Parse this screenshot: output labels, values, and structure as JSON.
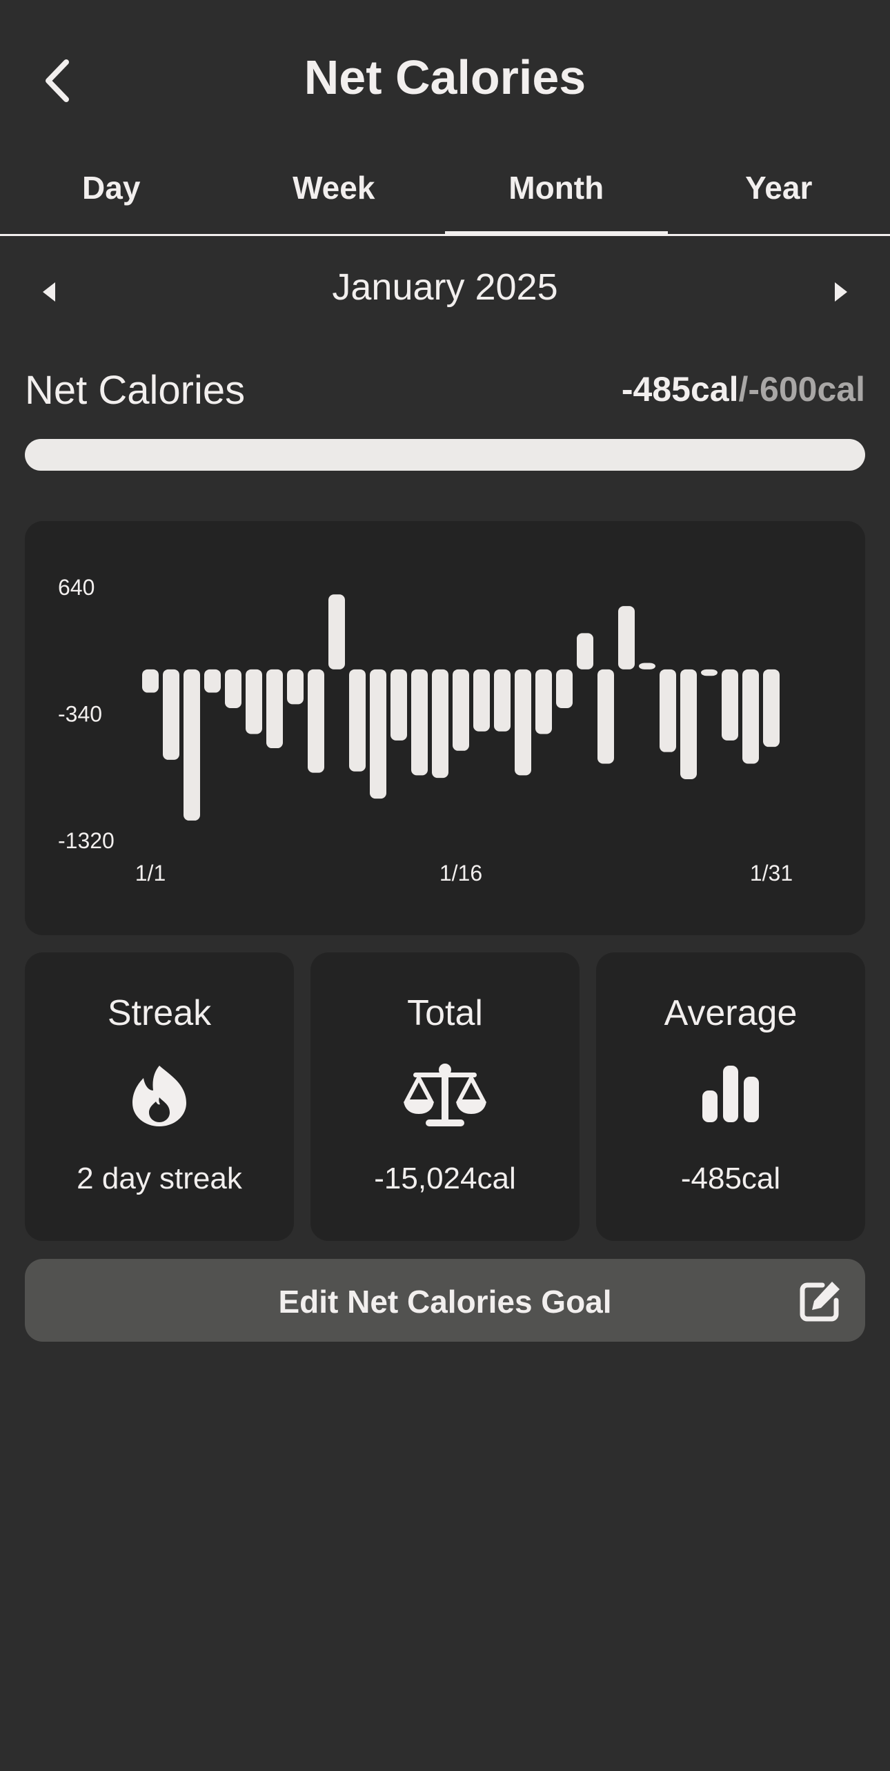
{
  "header": {
    "title": "Net Calories"
  },
  "tabs": [
    {
      "label": "Day"
    },
    {
      "label": "Week"
    },
    {
      "label": "Month"
    },
    {
      "label": "Year"
    }
  ],
  "active_tab": "Month",
  "period": {
    "label": "January 2025"
  },
  "summary": {
    "label": "Net Calories",
    "value": "-485cal",
    "separator": "/",
    "goal": "-600cal",
    "progress_fraction": 1.0
  },
  "chart_data": {
    "type": "bar",
    "x": [
      "1/1",
      "1/2",
      "1/3",
      "1/4",
      "1/5",
      "1/6",
      "1/7",
      "1/8",
      "1/9",
      "1/10",
      "1/11",
      "1/12",
      "1/13",
      "1/14",
      "1/15",
      "1/16",
      "1/17",
      "1/18",
      "1/19",
      "1/20",
      "1/21",
      "1/22",
      "1/23",
      "1/24",
      "1/25",
      "1/26",
      "1/27",
      "1/28",
      "1/29",
      "1/30",
      "1/31"
    ],
    "values": [
      -180,
      -700,
      -1170,
      -180,
      -300,
      -500,
      -610,
      -270,
      -800,
      580,
      -790,
      -1000,
      -550,
      -820,
      -840,
      -630,
      -480,
      -480,
      -820,
      -500,
      -300,
      280,
      -730,
      490,
      50,
      -640,
      -850,
      -50,
      -550,
      -730,
      -600
    ],
    "x_tick_labels": [
      "1/1",
      "1/16",
      "1/31"
    ],
    "y_tick_labels": [
      "640",
      "-340",
      "-1320"
    ],
    "ylim": [
      -1320,
      640
    ],
    "grid": false,
    "bar_color": "#ece9e7"
  },
  "stats": {
    "streak": {
      "title": "Streak",
      "value": "2 day streak",
      "icon": "flame-icon"
    },
    "total": {
      "title": "Total",
      "value": "-15,024cal",
      "icon": "scale-icon"
    },
    "average": {
      "title": "Average",
      "value": "-485cal",
      "icon": "bar-chart-icon"
    }
  },
  "edit_goal": {
    "label": "Edit Net Calories Goal",
    "icon": "edit-icon"
  }
}
